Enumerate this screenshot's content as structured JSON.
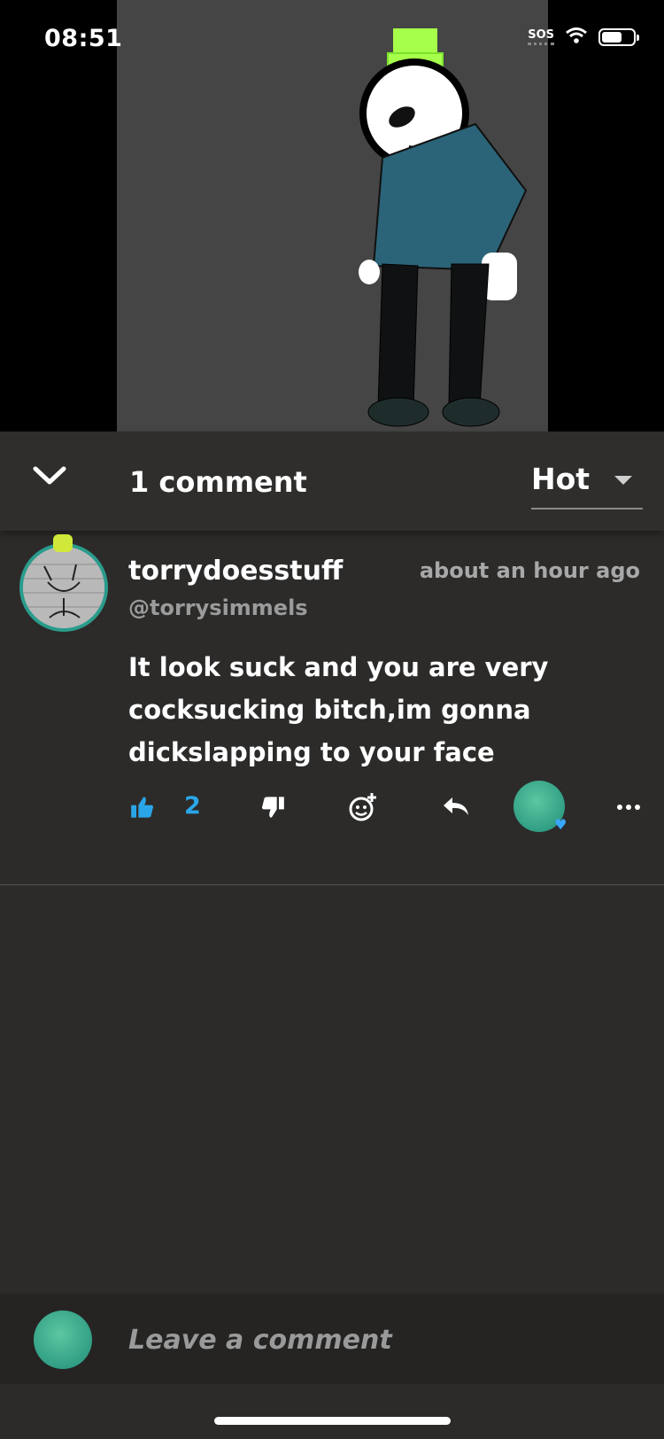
{
  "status_bar": {
    "time": "08:51",
    "sos": "SOS"
  },
  "comments_header": {
    "count_label": "1 comment",
    "sort_value": "Hot"
  },
  "comment": {
    "username": "torrydoesstuff",
    "handle": "@torrysimmels",
    "timestamp": "about an hour ago",
    "body": "It look suck and you are very cocksucking bitch,im gonna dickslapping to your face",
    "like_count": "2"
  },
  "composer": {
    "placeholder": "Leave a comment"
  },
  "colors": {
    "accent": "#2aa6e8",
    "background": "#2c2b2a",
    "avatar_ring": "#2a9c8c"
  },
  "icons": [
    "chevron-down-icon",
    "thumbs-up-icon",
    "thumbs-down-icon",
    "add-reaction-icon",
    "reply-icon",
    "more-icon",
    "wifi-icon",
    "battery-icon"
  ]
}
